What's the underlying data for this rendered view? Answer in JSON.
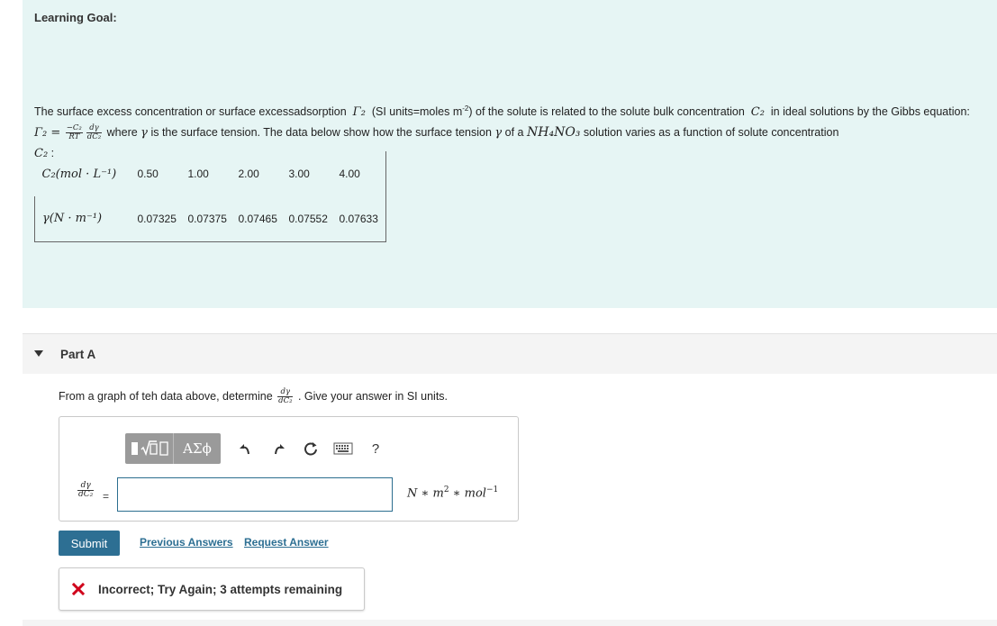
{
  "learning_goal": {
    "title": "Learning Goal:",
    "para_1": "The surface excess concentration or surface excessadsorption",
    "gamma2": "Γ₂",
    "para_2": "(SI units=moles m",
    "para_2_sup": "-2",
    "para_3": ") of the solute is related to the solute bulk concentration",
    "c2": "C₂",
    "para_4": "in ideal solutions by the Gibbs equation:",
    "eq_lhs": "Γ₂ =",
    "frac1_num": "−C₂",
    "frac1_den": "RT",
    "frac2_num": "dγ",
    "frac2_den": "dC₂",
    "para_5": "where",
    "gamma": "γ",
    "para_6": "is the surface tension. The data below show how the surface tension",
    "para_7": "of a",
    "compound": "NH₄NO₃",
    "para_8": "solution varies as a function of solute concentration",
    "para_9": ":"
  },
  "table": {
    "row1_header": "C₂(mol · L⁻¹)",
    "row1_values": [
      "0.50",
      "1.00",
      "2.00",
      "3.00",
      "4.00"
    ],
    "row2_header": "γ(N · m⁻¹)",
    "row2_values": [
      "0.07325",
      "0.07375",
      "0.07465",
      "0.07552",
      "0.07633"
    ]
  },
  "part_a": {
    "label": "Part A",
    "question_1": "From a graph of teh data above, determine",
    "q_frac_num": "dγ",
    "q_frac_den": "dC₂",
    "question_2": ". Give your answer in SI units.",
    "lhs_num": "dγ",
    "lhs_den": "dC₂",
    "equals": "=",
    "answer_value": "",
    "units": "N ∗ m",
    "units_sup1": "2",
    "units_mid": " ∗ mol",
    "units_sup2": "−1",
    "toolbar": {
      "greek_label": "ΑΣϕ",
      "help_label": "?",
      "icons": [
        "templates-icon",
        "greek-icon",
        "undo-icon",
        "redo-icon",
        "reset-icon",
        "keyboard-icon",
        "help-icon"
      ]
    },
    "submit_label": "Submit",
    "previous_answers_label": "Previous Answers",
    "request_answer_label": "Request Answer",
    "feedback": "Incorrect; Try Again; 3 attempts remaining"
  },
  "colors": {
    "goal_bg": "#e6f5f4",
    "accent": "#2d6f93",
    "error": "#d0021b"
  }
}
